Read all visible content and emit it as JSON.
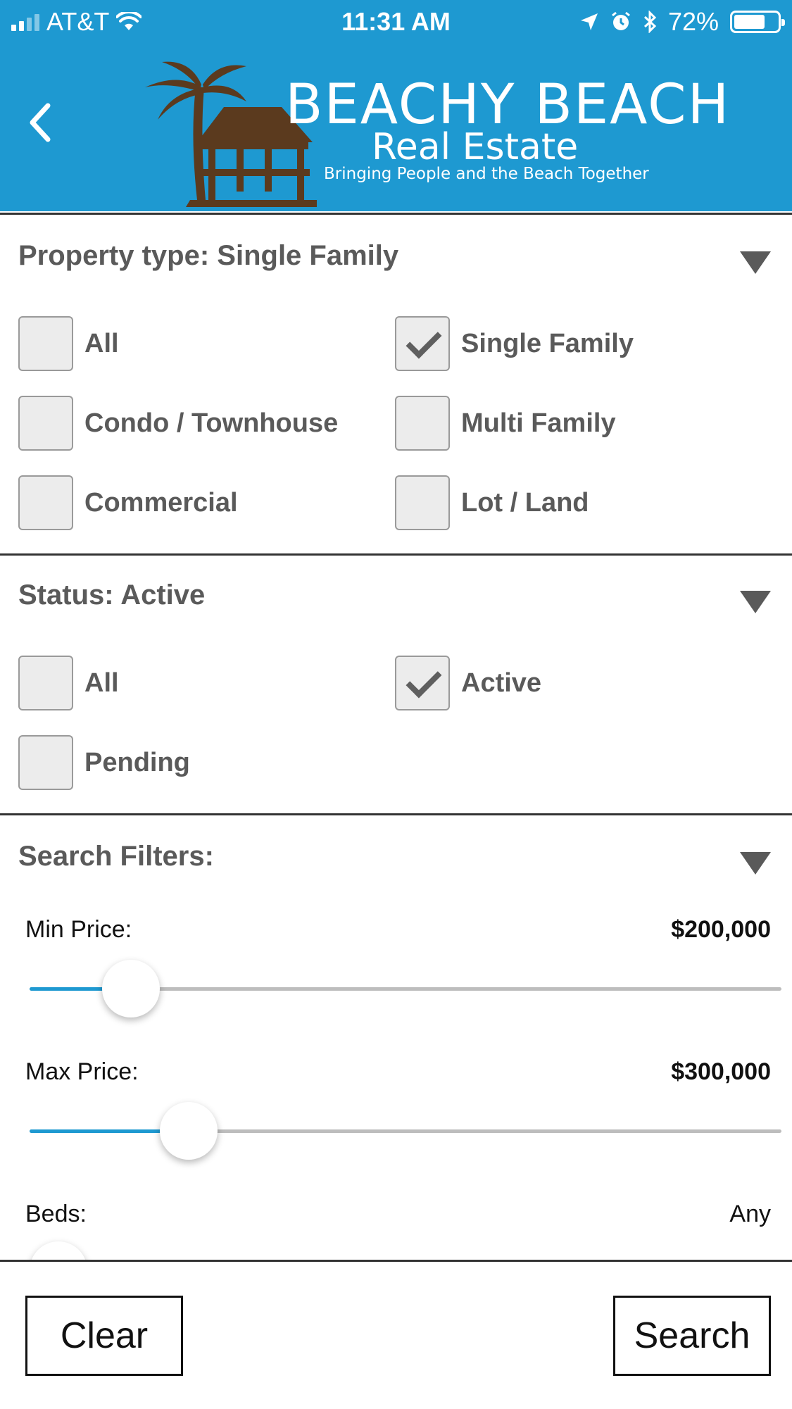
{
  "status_bar": {
    "carrier": "AT&T",
    "time": "11:31 AM",
    "battery": "72%",
    "battery_level": 0.72,
    "signal_bars": 2,
    "icons": [
      "wifi-icon",
      "location-arrow-icon",
      "alarm-icon",
      "bluetooth-icon",
      "battery-icon"
    ]
  },
  "header": {
    "back_icon": "chevron-left-icon",
    "logo": {
      "title": "BEACHY BEACH",
      "subtitle": "Real Estate",
      "tagline": "Bringing People and the Beach Together"
    },
    "background_color": "#1e99d1",
    "logo_art_color": "#5b3a1e"
  },
  "property_type": {
    "title": "Property type: Single Family",
    "options": [
      {
        "label": "All",
        "checked": false
      },
      {
        "label": "Single Family",
        "checked": true
      },
      {
        "label": "Condo / Townhouse",
        "checked": false
      },
      {
        "label": "Multi Family",
        "checked": false
      },
      {
        "label": "Commercial",
        "checked": false
      },
      {
        "label": "Lot / Land",
        "checked": false
      }
    ]
  },
  "status": {
    "title": "Status: Active",
    "options": [
      {
        "label": "All",
        "checked": false
      },
      {
        "label": "Active",
        "checked": true
      },
      {
        "label": "Pending",
        "checked": false
      }
    ]
  },
  "filters": {
    "title": "Search Filters:",
    "min_price": {
      "label": "Min Price:",
      "value": "$200,000",
      "position": 0.135
    },
    "max_price": {
      "label": "Max Price:",
      "value": "$300,000",
      "position": 0.212
    },
    "beds": {
      "label": "Beds:",
      "value": "Any",
      "position": 0.0
    }
  },
  "actions": {
    "clear_label": "Clear",
    "search_label": "Search"
  },
  "colors": {
    "accent": "#1e99d1",
    "text": "#5a5a5a",
    "checkbox_fill": "#ececec"
  }
}
